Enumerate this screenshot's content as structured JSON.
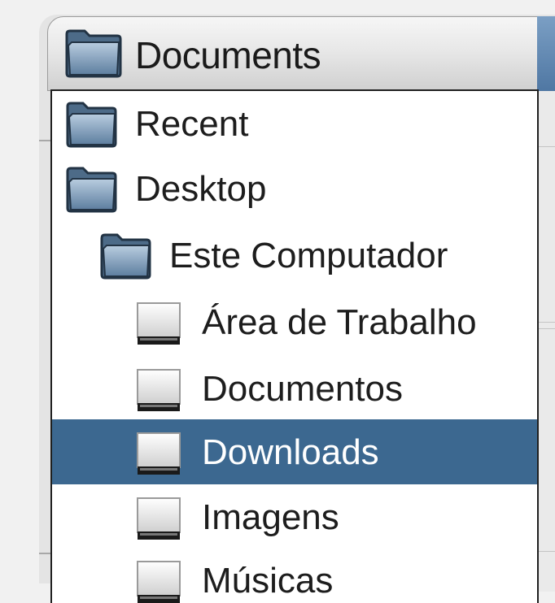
{
  "combo": {
    "icon": "folder-icon",
    "label": "Documents"
  },
  "dropdown": {
    "items": [
      {
        "label": "Recent",
        "icon": "folder-icon",
        "level": 0,
        "selected": false
      },
      {
        "label": "Desktop",
        "icon": "folder-icon",
        "level": 0,
        "selected": false
      },
      {
        "label": "Este Computador",
        "icon": "folder-icon",
        "level": 1,
        "selected": false
      },
      {
        "label": "Área de Trabalho",
        "icon": "drive-icon",
        "level": 2,
        "selected": false
      },
      {
        "label": "Documentos",
        "icon": "drive-icon",
        "level": 2,
        "selected": false
      },
      {
        "label": "Downloads",
        "icon": "drive-icon",
        "level": 2,
        "selected": true
      },
      {
        "label": "Imagens",
        "icon": "drive-icon",
        "level": 2,
        "selected": false
      },
      {
        "label": "Músicas",
        "icon": "drive-icon",
        "level": 2,
        "selected": false
      }
    ]
  },
  "colors": {
    "selection": "#3c6890",
    "selected_text": "#ffffff",
    "text": "#1d1d1d"
  }
}
